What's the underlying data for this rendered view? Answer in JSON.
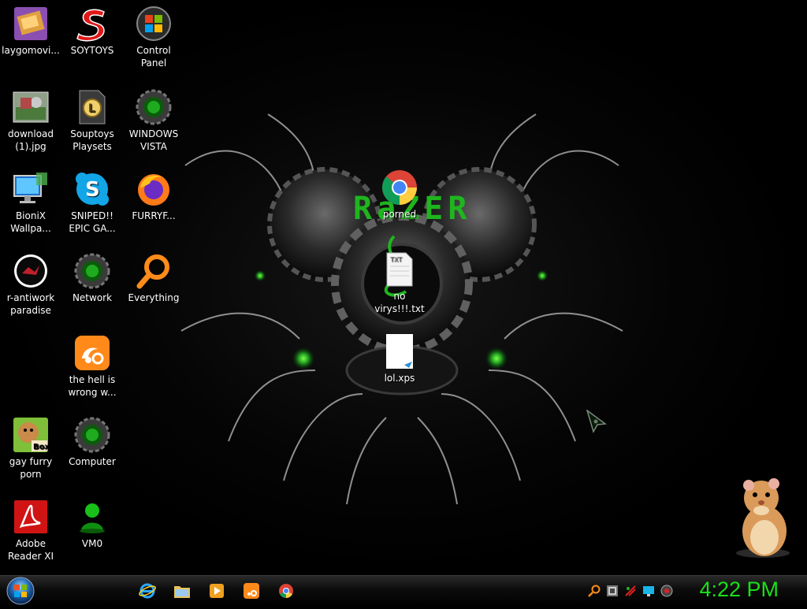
{
  "desktop": {
    "wallpaper_text": "RaZER",
    "icons": [
      {
        "label": "laygomovi...",
        "icon": "movie-file-icon"
      },
      {
        "label": "SOYTOYS",
        "icon": "red-s-logo-icon"
      },
      {
        "label": "Control Panel",
        "icon": "control-panel-icon"
      },
      {
        "label": "download (1).jpg",
        "icon": "image-file-icon"
      },
      {
        "label": "Souptoys Playsets",
        "icon": "souptoys-icon"
      },
      {
        "label": "WINDOWS VISTA",
        "icon": "green-orb-icon"
      },
      {
        "label": "BioniX Wallpa...",
        "icon": "monitor-icon"
      },
      {
        "label": "SNIPED!! EPIC GA...",
        "icon": "skype-icon"
      },
      {
        "label": "FURRYF...",
        "icon": "firefox-icon"
      },
      {
        "label": "r-antiwork paradise",
        "icon": "round-red-icon"
      },
      {
        "label": "Network",
        "icon": "green-orb-icon"
      },
      {
        "label": "Everything",
        "icon": "magnifier-icon"
      },
      {
        "label": "the hell is wrong w...",
        "icon": "uc-browser-icon"
      },
      {
        "label": "gay furry porn",
        "icon": "hamster-box-icon"
      },
      {
        "label": "Computer",
        "icon": "green-orb-icon"
      },
      {
        "label": "Adobe Reader XI",
        "icon": "adobe-reader-icon"
      },
      {
        "label": "VM0",
        "icon": "green-user-icon"
      },
      {
        "label": "porned",
        "icon": "chrome-icon"
      },
      {
        "label": "no virys!!!.txt",
        "icon": "text-file-icon"
      },
      {
        "label": "lol.xps",
        "icon": "xps-file-icon"
      }
    ]
  },
  "taskbar": {
    "start_label": "Start",
    "pinned": [
      {
        "icon": "internet-explorer-icon"
      },
      {
        "icon": "file-explorer-icon"
      },
      {
        "icon": "media-player-icon"
      },
      {
        "icon": "uc-browser-icon"
      },
      {
        "icon": "chrome-icon"
      }
    ],
    "tray": [
      {
        "icon": "everything-tray-icon"
      },
      {
        "icon": "network-tray-icon"
      },
      {
        "icon": "razer-tray-icon"
      },
      {
        "icon": "display-tray-icon"
      },
      {
        "icon": "volume-tray-icon"
      }
    ],
    "clock": "4:22 PM"
  },
  "colors": {
    "clock": "#18e018",
    "accent_green": "#1fb51f"
  }
}
